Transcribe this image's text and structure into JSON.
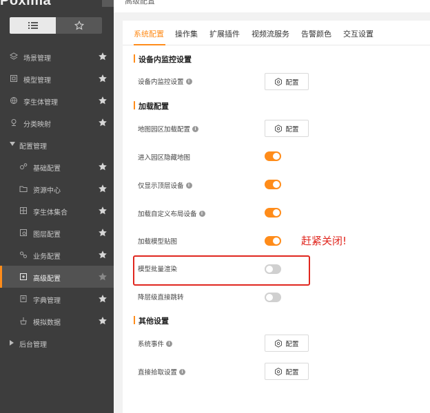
{
  "app": {
    "logo": "Poxima",
    "breadcrumb": "高级配置"
  },
  "sidebar": {
    "items": [
      {
        "label": "场景管理",
        "icon": "layers-icon"
      },
      {
        "label": "模型管理",
        "icon": "cube-icon"
      },
      {
        "label": "孪生体管理",
        "icon": "globe-icon"
      },
      {
        "label": "分类映射",
        "icon": "map-pin-icon"
      },
      {
        "label": "配置管理",
        "icon": "caret-down-icon"
      },
      {
        "label": "基础配置",
        "icon": "gears-icon"
      },
      {
        "label": "资源中心",
        "icon": "folder-icon"
      },
      {
        "label": "孪生体集合",
        "icon": "grid-icon"
      },
      {
        "label": "图层配置",
        "icon": "image-icon"
      },
      {
        "label": "业务配置",
        "icon": "nodes-icon"
      },
      {
        "label": "高级配置",
        "icon": "advanced-icon"
      },
      {
        "label": "字典管理",
        "icon": "book-icon"
      },
      {
        "label": "模拟数据",
        "icon": "broom-icon"
      },
      {
        "label": "后台管理",
        "icon": "caret-right-icon"
      }
    ]
  },
  "tabs": [
    "系统配置",
    "操作集",
    "扩展插件",
    "视频流服务",
    "告警颜色",
    "交互设置"
  ],
  "sections": {
    "monitor": "设备内监控设置",
    "loading": "加载配置",
    "other": "其他设置"
  },
  "rows": {
    "monitor_setting": "设备内监控设置",
    "park_loading": "地图园区加载配置",
    "hide_map": "进入园区隐藏地图",
    "top_device_only": "仅显示顶层设备",
    "custom_layout": "加载自定义布局设备",
    "model_texture": "加载模型贴图",
    "batch_render": "模型批量渲染",
    "jump_level": "降层级直接跳转",
    "sys_event": "系统事件",
    "pick_setting": "直接拾取设置"
  },
  "toggles": {
    "hide_map": true,
    "top_device_only": true,
    "custom_layout": true,
    "model_texture": true,
    "batch_render": false,
    "jump_level": false
  },
  "button_label": "配置",
  "annotation": "赶紧关闭!",
  "colors": {
    "accent": "#ff8c1a",
    "annotation": "#e0261e",
    "sidebar": "#3d3d3d"
  }
}
